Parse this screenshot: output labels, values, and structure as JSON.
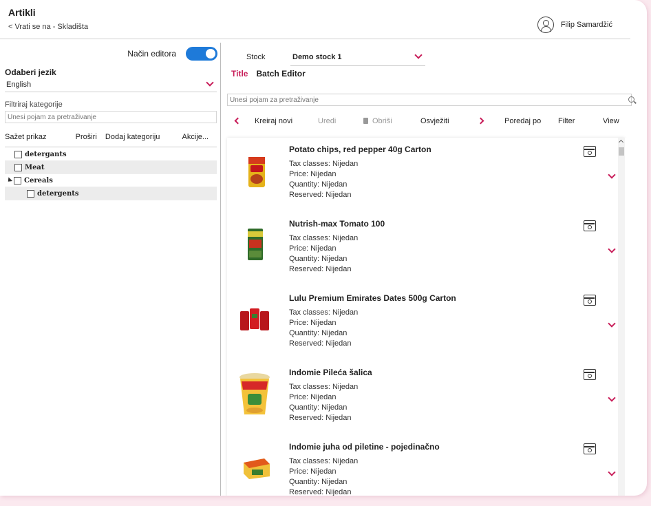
{
  "header": {
    "title": "Artikli",
    "back_link": "< Vrati se na - Skladišta",
    "user_name": "Filip Samardžić"
  },
  "left": {
    "editor_mode_label": "Način editora",
    "editor_mode_on": true,
    "language_label": "Odaberi jezik",
    "language_value": "English",
    "filter_label": "Filtriraj kategorije",
    "filter_placeholder": "Unesi pojam za pretraživanje",
    "actions": [
      "Sažet prikaz",
      "Proširi",
      "Dodaj kategoriju",
      "Akcije..."
    ],
    "categories": [
      {
        "label": "detergants",
        "level": 0,
        "expanded": null
      },
      {
        "label": "Meat",
        "level": 0,
        "expanded": null
      },
      {
        "label": "Cereals",
        "level": 0,
        "expanded": true
      },
      {
        "label": "detergents",
        "level": 1,
        "expanded": null
      }
    ]
  },
  "right": {
    "stock_label": "Stock",
    "stock_value": "Demo stock 1",
    "tabs": [
      "Title",
      "Batch Editor"
    ],
    "search_placeholder": "Unesi pojam za pretraživanje",
    "toolbar": {
      "create": "Kreiraj novi",
      "edit": "Uredi",
      "delete": "Obriši",
      "refresh": "Osvježiti",
      "sort": "Poredaj po",
      "filter": "Filter",
      "view": "View"
    },
    "items": [
      {
        "title": "Potato chips, red pepper 40g Carton",
        "tax": "Tax classes: Nijedan",
        "price": "Price: Nijedan",
        "quantity": "Quantity: Nijedan",
        "reserved": "Reserved: Nijedan"
      },
      {
        "title": "Nutrish-max Tomato 100",
        "tax": "Tax classes: Nijedan",
        "price": "Price: Nijedan",
        "quantity": "Quantity: Nijedan",
        "reserved": "Reserved: Nijedan"
      },
      {
        "title": "Lulu Premium Emirates Dates 500g Carton",
        "tax": "Tax classes: Nijedan",
        "price": "Price: Nijedan",
        "quantity": "Quantity: Nijedan",
        "reserved": "Reserved: Nijedan"
      },
      {
        "title": "Indomie Pileća šalica",
        "tax": "Tax classes: Nijedan",
        "price": "Price: Nijedan",
        "quantity": "Quantity: Nijedan",
        "reserved": "Reserved: Nijedan"
      },
      {
        "title": "Indomie juha od piletine - pojedinačno",
        "tax": "Tax classes: Nijedan",
        "price": "Price: Nijedan",
        "quantity": "Quantity: Nijedan",
        "reserved": "Reserved: Nijedan"
      }
    ]
  },
  "colors": {
    "accent": "#c81e5a",
    "toggle": "#1e7ad9",
    "background": "#fbe9ef"
  }
}
